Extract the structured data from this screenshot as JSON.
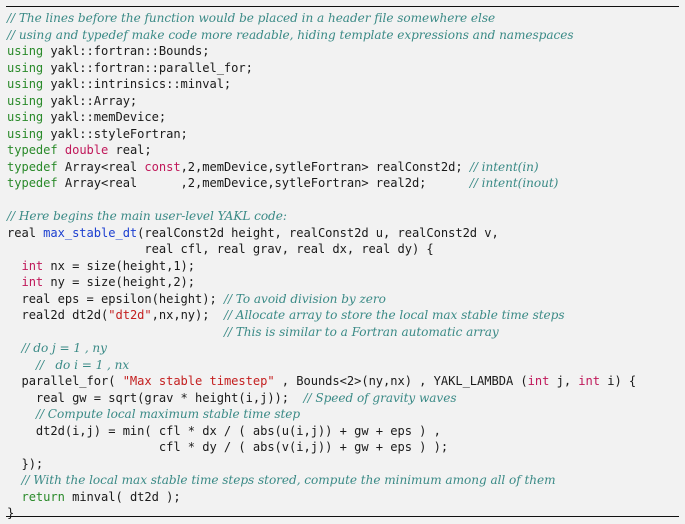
{
  "document": {
    "type": "code-listing",
    "language": "C++",
    "lines": [
      [
        {
          "t": "c",
          "v": "// The lines before the function would be placed in a header file somewhere else"
        }
      ],
      [
        {
          "t": "c",
          "v": "// using and typedef make code more readable, hiding template expressions and namespaces"
        }
      ],
      [
        {
          "t": "kw",
          "v": "using"
        },
        {
          "t": "p",
          "v": " yakl::fortran::Bounds;"
        }
      ],
      [
        {
          "t": "kw",
          "v": "using"
        },
        {
          "t": "p",
          "v": " yakl::fortran::parallel_for;"
        }
      ],
      [
        {
          "t": "kw",
          "v": "using"
        },
        {
          "t": "p",
          "v": " yakl::intrinsics::minval;"
        }
      ],
      [
        {
          "t": "kw",
          "v": "using"
        },
        {
          "t": "p",
          "v": " yakl::Array;"
        }
      ],
      [
        {
          "t": "kw",
          "v": "using"
        },
        {
          "t": "p",
          "v": " yakl::memDevice;"
        }
      ],
      [
        {
          "t": "kw",
          "v": "using"
        },
        {
          "t": "p",
          "v": " yakl::styleFortran;"
        }
      ],
      [
        {
          "t": "kw",
          "v": "typedef"
        },
        {
          "t": "p",
          "v": " "
        },
        {
          "t": "ty",
          "v": "double"
        },
        {
          "t": "p",
          "v": " real;"
        }
      ],
      [
        {
          "t": "kw",
          "v": "typedef"
        },
        {
          "t": "p",
          "v": " Array<real "
        },
        {
          "t": "ty",
          "v": "const"
        },
        {
          "t": "p",
          "v": ",2,memDevice,sytleFortran> realConst2d; "
        },
        {
          "t": "c",
          "v": "// intent(in)"
        }
      ],
      [
        {
          "t": "kw",
          "v": "typedef"
        },
        {
          "t": "p",
          "v": " Array<real      ,2,memDevice,sytleFortran> real2d;      "
        },
        {
          "t": "c",
          "v": "// intent(inout)"
        }
      ],
      [
        {
          "t": "p",
          "v": ""
        }
      ],
      [
        {
          "t": "c",
          "v": "// Here begins the main user-level YAKL code:"
        }
      ],
      [
        {
          "t": "p",
          "v": "real "
        },
        {
          "t": "fn",
          "v": "max_stable_dt"
        },
        {
          "t": "p",
          "v": "(realConst2d height, realConst2d u, realConst2d v,"
        }
      ],
      [
        {
          "t": "p",
          "v": "                   real cfl, real grav, real dx, real dy) {"
        }
      ],
      [
        {
          "t": "p",
          "v": "  "
        },
        {
          "t": "ty",
          "v": "int"
        },
        {
          "t": "p",
          "v": " nx = size(height,1);"
        }
      ],
      [
        {
          "t": "p",
          "v": "  "
        },
        {
          "t": "ty",
          "v": "int"
        },
        {
          "t": "p",
          "v": " ny = size(height,2);"
        }
      ],
      [
        {
          "t": "p",
          "v": "  real eps = epsilon(height); "
        },
        {
          "t": "c",
          "v": "// To avoid division by zero"
        }
      ],
      [
        {
          "t": "p",
          "v": "  real2d dt2d("
        },
        {
          "t": "st",
          "v": "\"dt2d\""
        },
        {
          "t": "p",
          "v": ",nx,ny);  "
        },
        {
          "t": "c",
          "v": "// Allocate array to store the local max stable time steps"
        }
      ],
      [
        {
          "t": "p",
          "v": "                              "
        },
        {
          "t": "c",
          "v": "// This is similar to a Fortran automatic array"
        }
      ],
      [
        {
          "t": "p",
          "v": "  "
        },
        {
          "t": "c",
          "v": "// do j = 1 , ny"
        }
      ],
      [
        {
          "t": "p",
          "v": "    "
        },
        {
          "t": "c",
          "v": "//   do i = 1 , nx"
        }
      ],
      [
        {
          "t": "p",
          "v": "  parallel_for( "
        },
        {
          "t": "st",
          "v": "\"Max stable timestep\""
        },
        {
          "t": "p",
          "v": " , Bounds<2>(ny,nx) , YAKL_LAMBDA ("
        },
        {
          "t": "ty",
          "v": "int"
        },
        {
          "t": "p",
          "v": " j, "
        },
        {
          "t": "ty",
          "v": "int"
        },
        {
          "t": "p",
          "v": " i) {"
        }
      ],
      [
        {
          "t": "p",
          "v": "    real gw = sqrt(grav * height(i,j));  "
        },
        {
          "t": "c",
          "v": "// Speed of gravity waves"
        }
      ],
      [
        {
          "t": "p",
          "v": "    "
        },
        {
          "t": "c",
          "v": "// Compute local maximum stable time step"
        }
      ],
      [
        {
          "t": "p",
          "v": "    dt2d(i,j) = min( cfl * dx / ( abs(u(i,j)) + gw + eps ) ,"
        }
      ],
      [
        {
          "t": "p",
          "v": "                     cfl * dy / ( abs(v(i,j)) + gw + eps ) );"
        }
      ],
      [
        {
          "t": "p",
          "v": "  });"
        }
      ],
      [
        {
          "t": "p",
          "v": "  "
        },
        {
          "t": "c",
          "v": "// With the local max stable time steps stored, compute the minimum among all of them"
        }
      ],
      [
        {
          "t": "p",
          "v": "  "
        },
        {
          "t": "kw",
          "v": "return"
        },
        {
          "t": "p",
          "v": " minval( dt2d );"
        }
      ],
      [
        {
          "t": "p",
          "v": "}"
        }
      ]
    ]
  }
}
